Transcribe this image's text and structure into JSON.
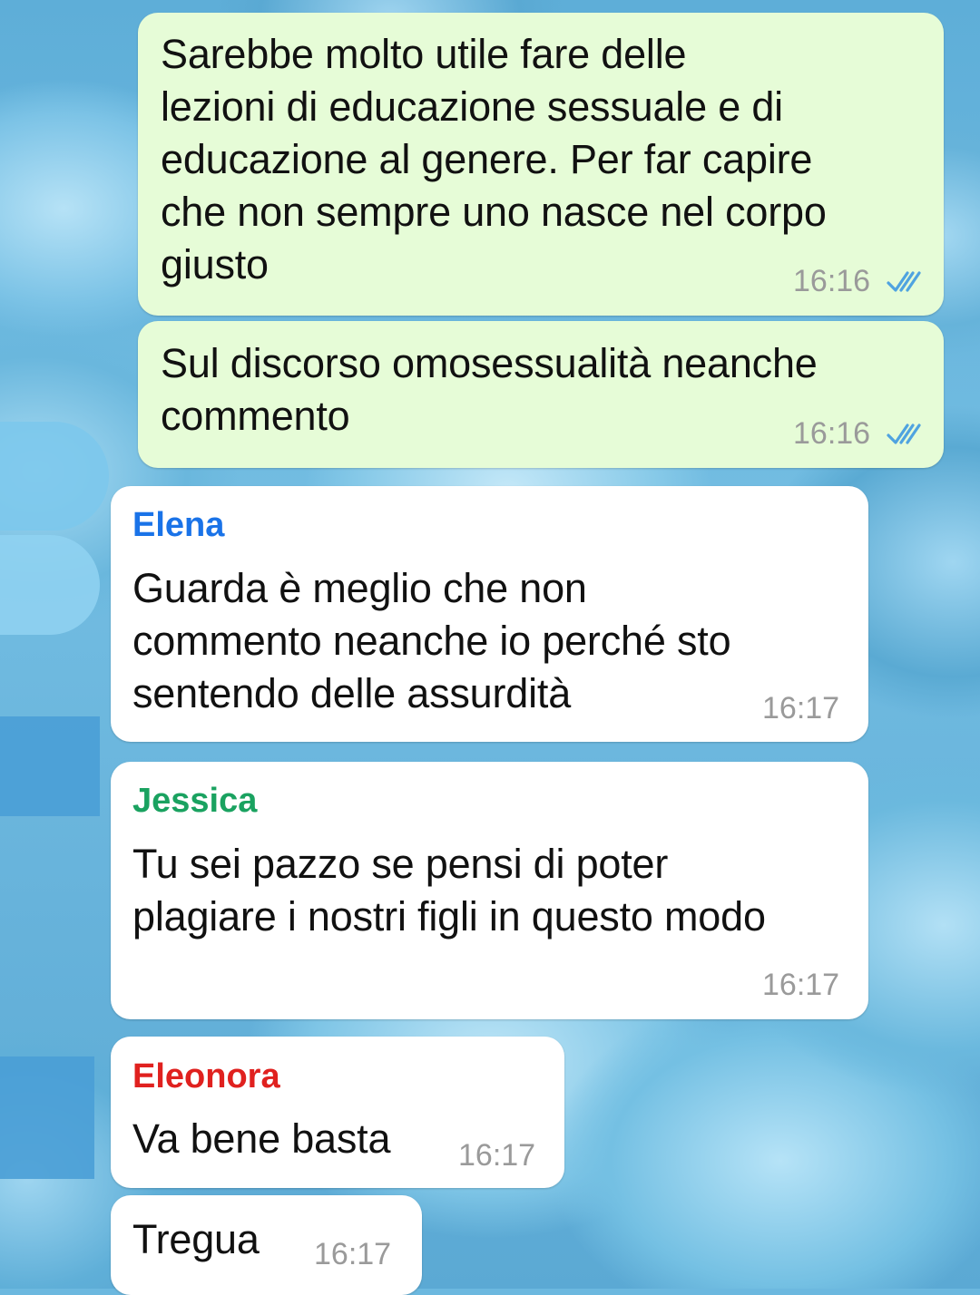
{
  "chat": {
    "messages": [
      {
        "direction": "outgoing",
        "text": "Sarebbe molto utile fare delle\nlezioni di educazione sessuale e di\neducazione al genere. Per far capire\nche non sempre uno nasce nel corpo\ngiusto",
        "time": "16:16",
        "status_icon": "double-check-read-icon"
      },
      {
        "direction": "outgoing",
        "text": "Sul discorso omosessualità neanche\ncommento",
        "time": "16:16",
        "status_icon": "double-check-read-icon"
      },
      {
        "direction": "incoming",
        "sender": "Elena",
        "sender_color": "#1a73e8",
        "text": "Guarda è meglio che non\ncommento neanche io perché sto\nsentendo delle assurdità",
        "time": "16:17"
      },
      {
        "direction": "incoming",
        "sender": "Jessica",
        "sender_color": "#1aa260",
        "text": "Tu sei pazzo se pensi di poter\nplagiare i nostri figli in questo modo",
        "time": "16:17"
      },
      {
        "direction": "incoming",
        "sender": "Eleonora",
        "sender_color": "#e0211f",
        "text": "Va bene basta",
        "time": "16:17"
      },
      {
        "direction": "incoming",
        "text": "Tregua",
        "time": "16:17"
      }
    ]
  },
  "colors": {
    "outgoing_bubble": "#e6fcd7",
    "incoming_bubble": "#ffffff",
    "read_ticks": "#4fa3e0",
    "timestamp": "#9a9a9a"
  }
}
